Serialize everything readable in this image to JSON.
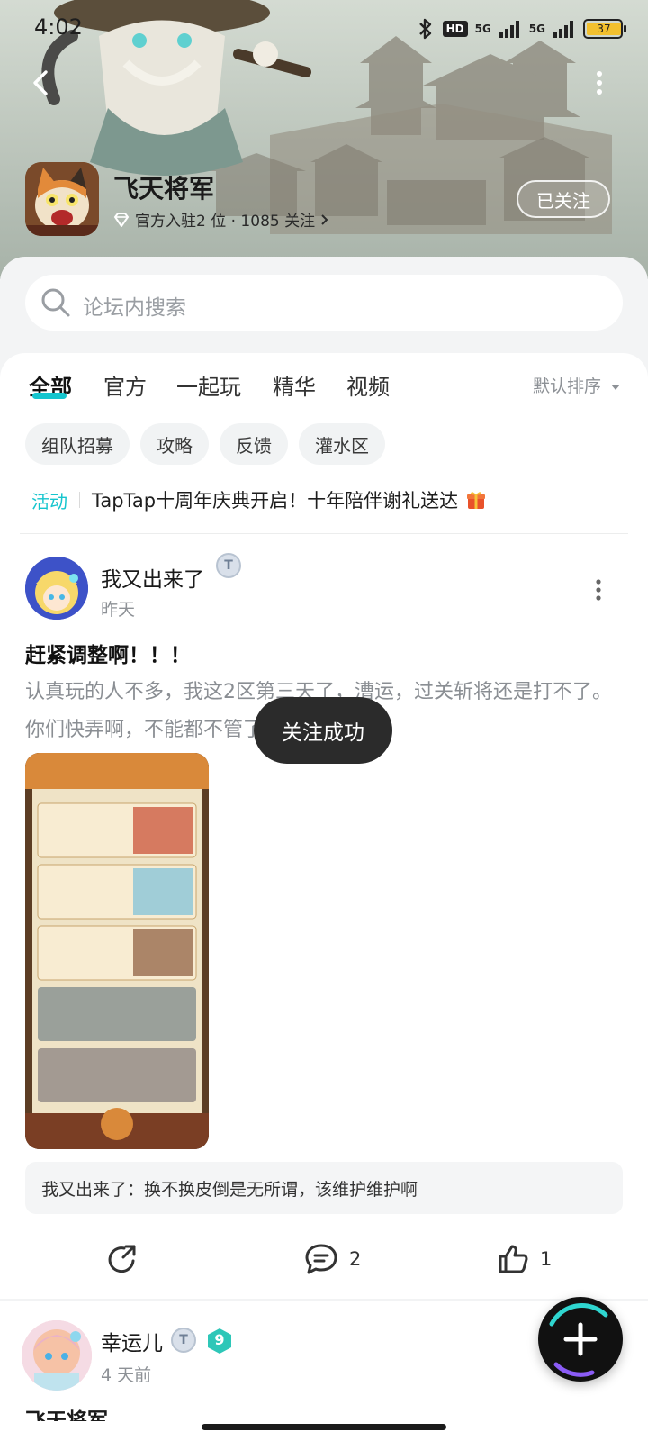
{
  "status_bar": {
    "time": "4:02",
    "hd": "HD",
    "signal1": "5G",
    "signal2": "5G",
    "battery": "37"
  },
  "game": {
    "name": "飞天将军",
    "meta": "官方入驻2 位 · 1085 关注",
    "follow_label": "已关注"
  },
  "search": {
    "placeholder": "论坛内搜索"
  },
  "tabs": [
    {
      "label": "全部"
    },
    {
      "label": "官方"
    },
    {
      "label": "一起玩"
    },
    {
      "label": "精华"
    },
    {
      "label": "视频"
    }
  ],
  "sort": {
    "label": "默认排序"
  },
  "chips": [
    {
      "label": "组队招募"
    },
    {
      "label": "攻略"
    },
    {
      "label": "反馈"
    },
    {
      "label": "灌水区"
    }
  ],
  "event": {
    "tag": "活动",
    "text": "TapTap十周年庆典开启！十年陪伴谢礼送达"
  },
  "post": {
    "author": "我又出来了",
    "badge": "T",
    "time": "昨天",
    "title": "赶紧调整啊！！！",
    "body": "认真玩的人不多，我这2区第三天了，漕运，过关斩将还是打不了。你们快弄啊，不能都不管了吧？？？？？",
    "comment_preview": "我又出来了：换不换皮倒是无所谓，该维护维护啊",
    "comments": "2",
    "likes": "1"
  },
  "toast": {
    "text": "关注成功"
  },
  "post2": {
    "author": "幸运儿",
    "badge": "T",
    "level": "9",
    "time": "4 天前",
    "peek": "飞天将军"
  },
  "colors": {
    "accent": "#15c5ce",
    "toast_bg": "#2b2b2b"
  }
}
